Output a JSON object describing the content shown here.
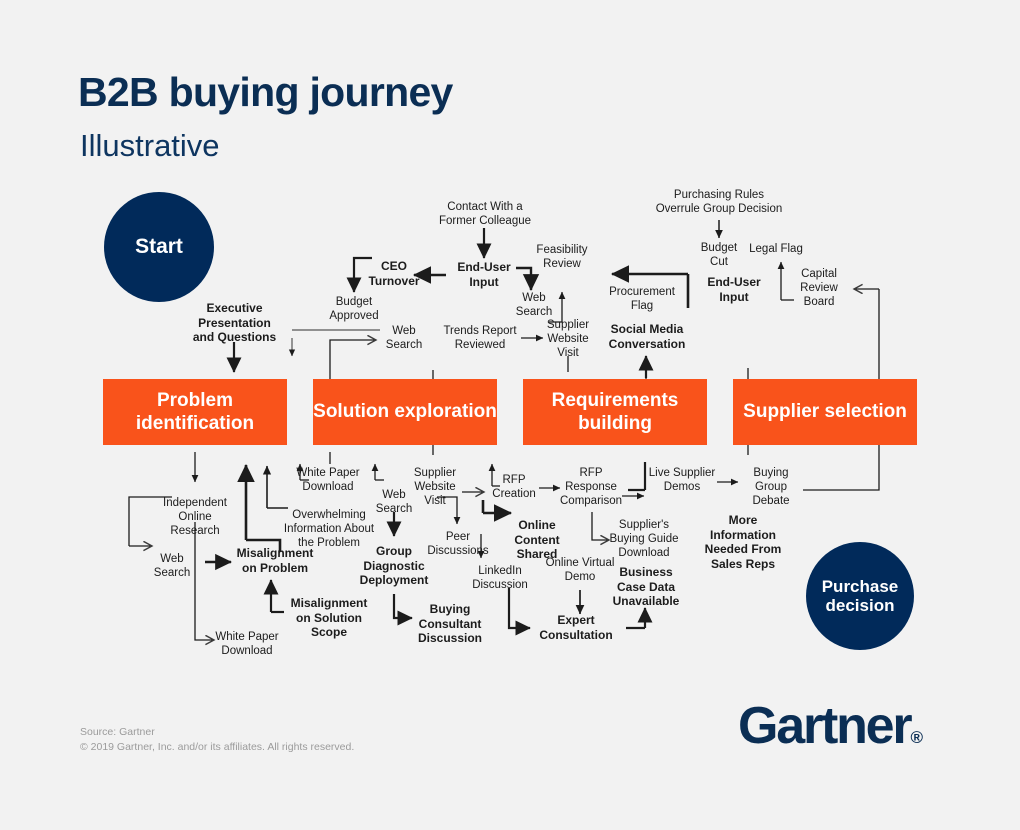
{
  "header": {
    "title": "B2B buying journey",
    "subtitle": "Illustrative"
  },
  "circles": {
    "start": "Start",
    "purchase": "Purchase\ndecision"
  },
  "stages": [
    {
      "id": "problem-identification",
      "label": "Problem\nidentification"
    },
    {
      "id": "solution-exploration",
      "label": "Solution\nexploration"
    },
    {
      "id": "requirements-building",
      "label": "Requirements\nbuilding"
    },
    {
      "id": "supplier-selection",
      "label": "Supplier\nselection"
    }
  ],
  "nodes_above": [
    {
      "id": "executive-presentation-and-questions",
      "label": "Executive\nPresentation\nand Questions",
      "bold": true
    },
    {
      "id": "ceo-turnover",
      "label": "CEO\nTurnover",
      "bold": true
    },
    {
      "id": "budget-approved",
      "label": "Budget\nApproved",
      "bold": false
    },
    {
      "id": "web-search-above-1",
      "label": "Web\nSearch",
      "bold": false
    },
    {
      "id": "contact-with-a-former-colleague",
      "label": "Contact With a\nFormer Colleague",
      "bold": false
    },
    {
      "id": "end-user-input-1",
      "label": "End-User\nInput",
      "bold": true
    },
    {
      "id": "trends-report-reviewed",
      "label": "Trends Report\nReviewed",
      "bold": false
    },
    {
      "id": "feasibility-review",
      "label": "Feasibility\nReview",
      "bold": false
    },
    {
      "id": "web-search-above-2",
      "label": "Web\nSearch",
      "bold": false
    },
    {
      "id": "supplier-website-visit-above",
      "label": "Supplier\nWebsite\nVisit",
      "bold": false
    },
    {
      "id": "procurement-flag",
      "label": "Procurement\nFlag",
      "bold": false
    },
    {
      "id": "social-media-conversation",
      "label": "Social Media\nConversation",
      "bold": true
    },
    {
      "id": "purchasing-rules-overrule-group-decision",
      "label": "Purchasing Rules\nOverrule Group Decision",
      "bold": false
    },
    {
      "id": "budget-cut",
      "label": "Budget\nCut",
      "bold": false
    },
    {
      "id": "end-user-input-2",
      "label": "End-User\nInput",
      "bold": true
    },
    {
      "id": "legal-flag",
      "label": "Legal Flag",
      "bold": false
    },
    {
      "id": "capital-review-board",
      "label": "Capital\nReview\nBoard",
      "bold": false
    }
  ],
  "nodes_below": [
    {
      "id": "independent-online-research",
      "label": "Independent\nOnline\nResearch",
      "bold": false
    },
    {
      "id": "web-search-below-1",
      "label": "Web\nSearch",
      "bold": false
    },
    {
      "id": "white-paper-download-1",
      "label": "White Paper\nDownload",
      "bold": false
    },
    {
      "id": "misalignment-on-problem",
      "label": "Misalignment\non Problem",
      "bold": true
    },
    {
      "id": "misalignment-on-solution-scope",
      "label": "Misalignment\non Solution\nScope",
      "bold": true
    },
    {
      "id": "white-paper-download-2",
      "label": "White Paper\nDownload",
      "bold": false
    },
    {
      "id": "overwhelming-information-about-the-problem",
      "label": "Overwhelming\nInformation About\nthe Problem",
      "bold": false
    },
    {
      "id": "web-search-below-2",
      "label": "Web\nSearch",
      "bold": false
    },
    {
      "id": "group-diagnostic-deployment",
      "label": "Group\nDiagnostic\nDeployment",
      "bold": true
    },
    {
      "id": "buying-consultant-discussion",
      "label": "Buying\nConsultant\nDiscussion",
      "bold": true
    },
    {
      "id": "supplier-website-visit-below",
      "label": "Supplier\nWebsite\nVisit",
      "bold": false
    },
    {
      "id": "peer-discussions",
      "label": "Peer\nDiscussions",
      "bold": false
    },
    {
      "id": "linkedin-discussion",
      "label": "LinkedIn\nDiscussion",
      "bold": false
    },
    {
      "id": "rfp-creation",
      "label": "RFP\nCreation",
      "bold": false
    },
    {
      "id": "online-content-shared",
      "label": "Online\nContent\nShared",
      "bold": true
    },
    {
      "id": "online-virtual-demo",
      "label": "Online Virtual\nDemo",
      "bold": false
    },
    {
      "id": "expert-consultation",
      "label": "Expert\nConsultation",
      "bold": true
    },
    {
      "id": "rfp-response-comparison",
      "label": "RFP\nResponse\nComparison",
      "bold": false
    },
    {
      "id": "suppliers-buying-guide-download",
      "label": "Supplier's\nBuying Guide\nDownload",
      "bold": false
    },
    {
      "id": "business-case-data-unavailable",
      "label": "Business\nCase Data\nUnavailable",
      "bold": true
    },
    {
      "id": "live-supplier-demos",
      "label": "Live Supplier\nDemos",
      "bold": false
    },
    {
      "id": "buying-group-debate",
      "label": "Buying\nGroup\nDebate",
      "bold": false
    },
    {
      "id": "more-information-needed-from-sales-reps",
      "label": "More\nInformation\nNeeded From\nSales Reps",
      "bold": true
    }
  ],
  "footer": {
    "source": "Source: Gartner\n© 2019 Gartner, Inc. and/or its affiliates. All rights reserved.",
    "logo": "Gartner",
    "logo_mark": "®"
  },
  "colors": {
    "background": "#f2f2f2",
    "navy": "#012a5a",
    "orange": "#f9531b",
    "text": "#1c1c1c",
    "muted": "#9b9b9b"
  }
}
